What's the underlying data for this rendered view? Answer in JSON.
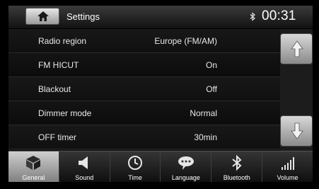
{
  "header": {
    "title": "Settings",
    "clock": "00:31",
    "home_icon": "home-icon",
    "bluetooth_icon": "bluetooth-status-icon"
  },
  "settings": [
    {
      "label": "Radio region",
      "value": "Europe (FM/AM)"
    },
    {
      "label": "FM HICUT",
      "value": "On"
    },
    {
      "label": "Blackout",
      "value": "Off"
    },
    {
      "label": "Dimmer mode",
      "value": "Normal"
    },
    {
      "label": "OFF timer",
      "value": "30min"
    }
  ],
  "scroll": {
    "up_icon": "arrow-up-icon",
    "down_icon": "arrow-down-icon"
  },
  "tabs": [
    {
      "label": "General",
      "icon": "cube-icon",
      "active": true
    },
    {
      "label": "Sound",
      "icon": "speaker-icon",
      "active": false
    },
    {
      "label": "Time",
      "icon": "clock-icon",
      "active": false
    },
    {
      "label": "Language",
      "icon": "speech-bubble-icon",
      "active": false
    },
    {
      "label": "Bluetooth",
      "icon": "bluetooth-icon",
      "active": false
    },
    {
      "label": "Volume",
      "icon": "volume-bars-icon",
      "active": false
    }
  ],
  "colors": {
    "accent_active_tab": "#bdbdbd",
    "background": "#121212",
    "text": "#ffffff"
  }
}
